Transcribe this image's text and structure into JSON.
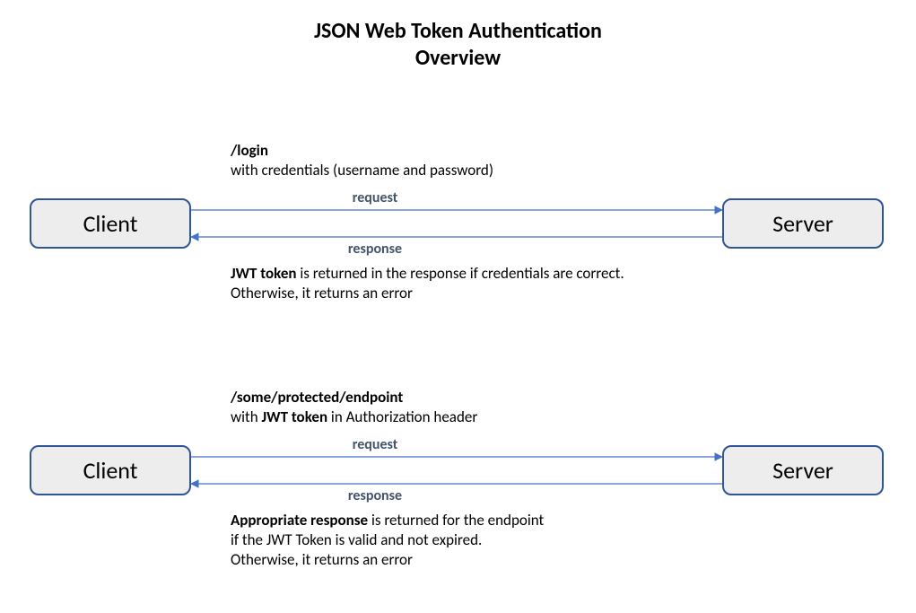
{
  "title_line1": "JSON Web Token Authentication",
  "title_line2": "Overview",
  "nodes": {
    "client": "Client",
    "server": "Server"
  },
  "arrows": {
    "request": "request",
    "response": "response"
  },
  "step1": {
    "top_endpoint": "/login",
    "top_desc": "with credentials (username and password)",
    "bottom_bold": "JWT token",
    "bottom_rest1": " is returned in the response if credentials are correct.",
    "bottom_line2": "Otherwise, it returns an error"
  },
  "step2": {
    "top_endpoint": "/some/protected/endpoint",
    "top_desc_pre": "with ",
    "top_desc_bold": "JWT token",
    "top_desc_post": " in Authorization header",
    "bottom_bold": "Appropriate response",
    "bottom_rest1": " is returned for the endpoint",
    "bottom_line2": "if the JWT Token is  valid and not expired.",
    "bottom_line3": "Otherwise, it returns an error"
  },
  "colors": {
    "node_border": "#2F5597",
    "node_fill": "#EDEDED",
    "arrow": "#4472C4",
    "label": "#44546A"
  }
}
